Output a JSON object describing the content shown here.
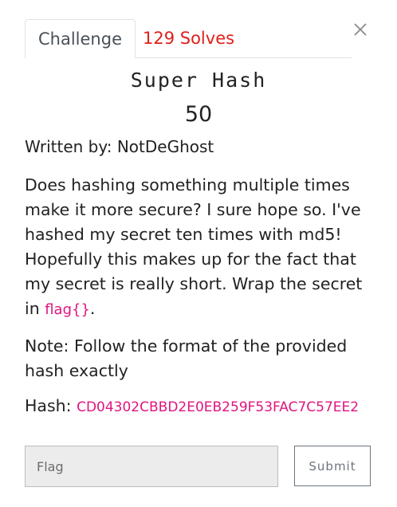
{
  "tabs": {
    "challenge_label": "Challenge",
    "solves_label": "129 Solves"
  },
  "challenge": {
    "name": "Super Hash",
    "points": "50",
    "author": "Written by: NotDeGhost",
    "description_text": "Does hashing something multiple times make it more secure? I sure hope so. I've hashed my secret ten times with md5! Hopefully this makes up for the fact that my secret is really short. Wrap the secret in ",
    "description_flag_format": "flag{}",
    "description_end": ".",
    "note": "Note: Follow the format of the provided hash exactly",
    "hash_label": "Hash: ",
    "hash_value": "CD04302CBBD2E0EB259F53FAC7C57EE2"
  },
  "form": {
    "flag_placeholder": "Flag",
    "flag_value": "",
    "submit_label": "Submit"
  },
  "colors": {
    "solves": "#e0201b",
    "accent_pink": "#e0147f"
  },
  "icons": {
    "close": "close-icon"
  }
}
